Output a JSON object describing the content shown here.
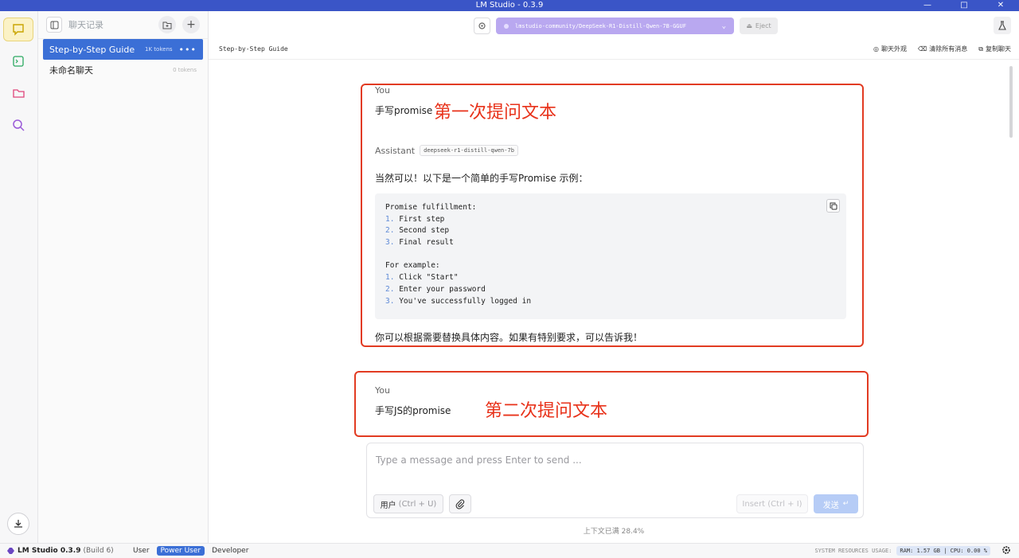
{
  "window": {
    "title": "LM Studio - 0.3.9"
  },
  "sidebar": {
    "header_label": "聊天记录",
    "chats": [
      {
        "name": "Step-by-Step Guide",
        "tokens": "1K tokens",
        "selected": true
      },
      {
        "name": "未命名聊天",
        "tokens": "0 tokens",
        "selected": false
      }
    ]
  },
  "topbar": {
    "model": "lmstudio-community/DeepSeek-R1-Distill-Qwen-7B-GGUF",
    "eject": "Eject"
  },
  "subbar": {
    "breadcrumb": "Step-by-Step Guide",
    "actions": {
      "appearance": "聊天外观",
      "clear": "清除所有消息",
      "duplicate": "复制聊天"
    }
  },
  "messages": {
    "m1": {
      "role": "You",
      "text": "手写promise",
      "annotation": "第一次提问文本"
    },
    "m2": {
      "role": "Assistant",
      "model_badge": "deepseek-r1-distill-qwen-7b",
      "intro": "当然可以！以下是一个简单的手写Promise 示例：",
      "code": [
        {
          "n": "",
          "t": "Promise fulfillment:"
        },
        {
          "n": "1.",
          "t": "First step"
        },
        {
          "n": "2.",
          "t": "Second step"
        },
        {
          "n": "3.",
          "t": "Final result"
        },
        {
          "n": "",
          "t": ""
        },
        {
          "n": "",
          "t": "For example:"
        },
        {
          "n": "1.",
          "t": "Click \"Start\""
        },
        {
          "n": "2.",
          "t": "Enter your password"
        },
        {
          "n": "3.",
          "t": "You've successfully logged in"
        }
      ],
      "outro": "你可以根据需要替换具体内容。如果有特别要求，可以告诉我！"
    },
    "m3": {
      "role": "You",
      "text": "手写JS的promise",
      "annotation": "第二次提问文本"
    }
  },
  "composer": {
    "placeholder": "Type a message and press Enter to send ...",
    "role_label": "用户",
    "role_shortcut": "(Ctrl + U)",
    "insert_label": "Insert (Ctrl + I)",
    "send_label": "发送"
  },
  "context_usage": "上下文已满 28.4%",
  "statusbar": {
    "app_name": "LM Studio 0.3.9",
    "build": "(Build 6)",
    "modes": [
      "User",
      "Power User",
      "Developer"
    ],
    "active_mode": "Power User",
    "resources_label": "SYSTEM RESOURCES USAGE:",
    "ram": "RAM: 1.57 GB",
    "cpu": "CPU: 0.00 %"
  },
  "colors": {
    "accent": "#3b6fd6",
    "annotation": "#e23b22",
    "model_pill": "#b9a8f0",
    "titlebar": "#3a55c7"
  }
}
